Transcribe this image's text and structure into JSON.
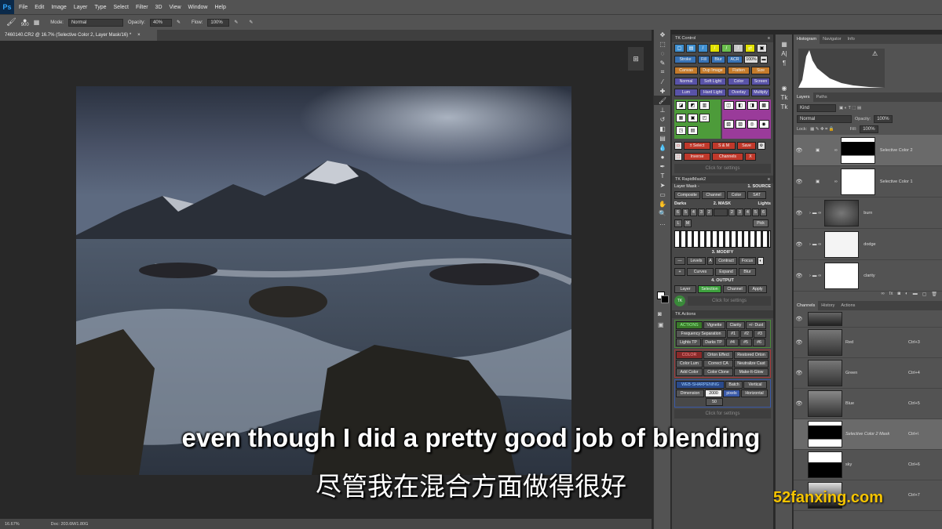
{
  "menu": {
    "app_icon": "Ps",
    "items": [
      "File",
      "Edit",
      "Image",
      "Layer",
      "Type",
      "Select",
      "Filter",
      "3D",
      "View",
      "Window",
      "Help"
    ]
  },
  "options": {
    "brush_size": "900",
    "mode_label": "Mode:",
    "mode_value": "Normal",
    "opacity_label": "Opacity:",
    "opacity_value": "40%",
    "flow_label": "Flow:",
    "flow_value": "100%"
  },
  "document": {
    "tab_title": "7460140.CR2 @ 16.7% (Selective Color 2, Layer Mask/16) *",
    "close": "×",
    "zoom": "16.67%",
    "doc_size": "Doc: 203.6M/1.80G"
  },
  "tk_control": {
    "title": "TK Control",
    "row1": [
      "Stroke",
      "Fill",
      "Blur",
      "ACR",
      "100%"
    ],
    "row2": [
      "Canvas",
      "Dup Image",
      "Flatten",
      "Size"
    ],
    "row3": [
      "Normal",
      "Soft Light",
      "Color",
      "Screen"
    ],
    "row4": [
      "Lum",
      "Hard Light",
      "Overlay",
      "Multiply"
    ],
    "sel_row": [
      "± Select",
      "S & M",
      "Save"
    ],
    "inv_row": [
      "Inverse",
      "Channels",
      "X"
    ],
    "click_settings": "Click for settings"
  },
  "rapidmask": {
    "title": "TK RapidMask2",
    "layer_mask": "Layer Mask -",
    "source_label": "1. SOURCE",
    "source_btns": [
      "Composite",
      "Channel",
      "Color",
      "SAT"
    ],
    "darks": "Darks",
    "mask_label": "2. MASK",
    "lights": "Lights",
    "nums_left": [
      "6",
      "5",
      "4",
      "3",
      "2"
    ],
    "nums_right": [
      "2",
      "3",
      "4",
      "5",
      "6"
    ],
    "pick": "Pick",
    "modify_label": "3. MODIFY",
    "modify_row1": [
      "Levels",
      "A",
      "Contract",
      "Focus"
    ],
    "modify_row2": [
      "Curves",
      "Expand",
      "Blur"
    ],
    "output_label": "4. OUTPUT",
    "output_btns": [
      "Layer",
      "Selection",
      "Channel",
      "Apply"
    ],
    "click_settings": "Click for settings"
  },
  "tk_actions": {
    "title": "TK Actions",
    "actions": [
      "ACTIONS",
      "Vignette",
      "Clarity",
      "+/- Dust",
      "Frequency Separation",
      "#1",
      "#2",
      "#3",
      "Lights TP",
      "Darks TP",
      "#4",
      "#5",
      "#6"
    ],
    "color": [
      "COLOR",
      "Orton Effect",
      "Restored Orton",
      "Color Lum",
      "Correct CA",
      "Neutralize Cast",
      "Add Color",
      "Color Clone",
      "Make-It-Glow"
    ],
    "web": [
      "WEB-SHARPENING",
      "Batch",
      "Vertical",
      "Dimension",
      "2000",
      "pixels",
      "Horizontal",
      "50"
    ],
    "click_settings": "Click for settings"
  },
  "histogram": {
    "tabs": [
      "Histogram",
      "Navigator",
      "Info"
    ]
  },
  "layers": {
    "tabs": [
      "Layers",
      "Paths"
    ],
    "kind": "Kind",
    "blend": "Normal",
    "opacity_label": "Opacity:",
    "opacity": "100%",
    "lock_label": "Lock:",
    "fill_label": "Fill:",
    "fill": "100%",
    "rows": [
      {
        "name": "Selective Color 2"
      },
      {
        "name": "Selective Color 1"
      },
      {
        "name": "burn"
      },
      {
        "name": "dodge"
      },
      {
        "name": "clarity"
      }
    ]
  },
  "channels": {
    "tabs": [
      "Channels",
      "History",
      "Actions"
    ],
    "rows": [
      {
        "name": "",
        "shortcut": ""
      },
      {
        "name": "Red",
        "shortcut": "Ctrl+3"
      },
      {
        "name": "Green",
        "shortcut": "Ctrl+4"
      },
      {
        "name": "Blue",
        "shortcut": "Ctrl+5"
      },
      {
        "name": "Selective Color 2 Mask",
        "shortcut": "Ctrl+\\"
      },
      {
        "name": "sky",
        "shortcut": "Ctrl+6"
      },
      {
        "name": "",
        "shortcut": "Ctrl+7"
      }
    ]
  },
  "subtitles": {
    "english": "even though I did a pretty good job of blending",
    "chinese": "尽管我在混合方面做得很好"
  },
  "watermark": "52fanxing.com"
}
